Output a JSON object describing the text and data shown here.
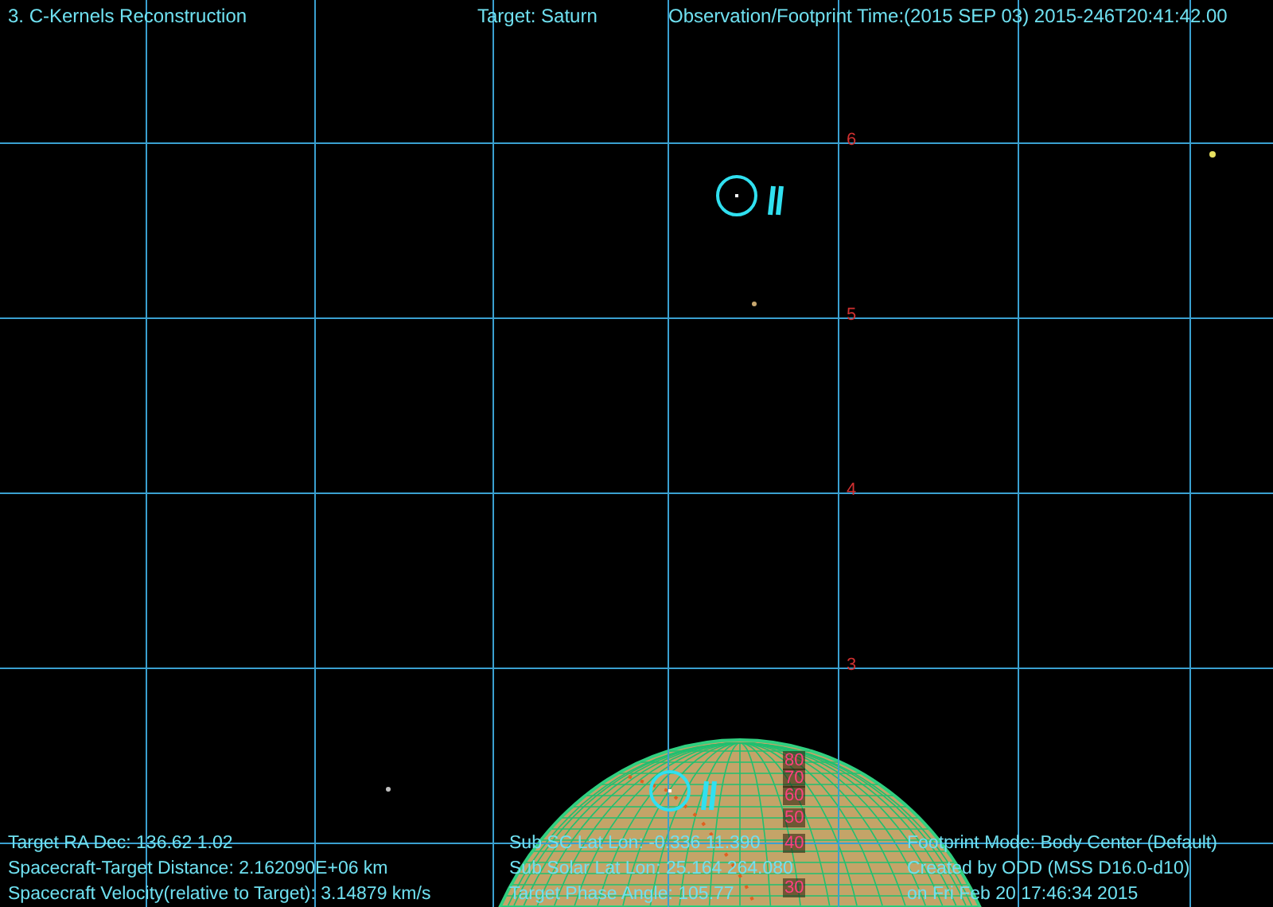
{
  "header": {
    "title": "3. C-Kernels Reconstruction",
    "target": "Target: Saturn",
    "time": "Observation/Footprint Time:(2015 SEP 03) 2015-246T20:41:42.00"
  },
  "axis_labels": [
    "6",
    "5",
    "4",
    "3"
  ],
  "latitude_labels": [
    "80",
    "70",
    "60",
    "50",
    "40",
    "30"
  ],
  "info_columns": [
    [
      "Target RA Dec: 136.62   1.02",
      "Spacecraft-Target Distance: 2.162090E+06 km",
      "Spacecraft Velocity(relative to Target): 3.14879 km/s"
    ],
    [
      "Sub SC Lat Lon: -0.336  11.390",
      "Sub Solar Lat Lon: 25.164  264.080",
      "Target Phase Angle: 105.77"
    ],
    [
      "Footprint Mode: Body Center (Default)",
      "Created by ODD (MSS D16.0-d10)",
      "on Fri Feb 20 17:46:34 2015"
    ]
  ]
}
